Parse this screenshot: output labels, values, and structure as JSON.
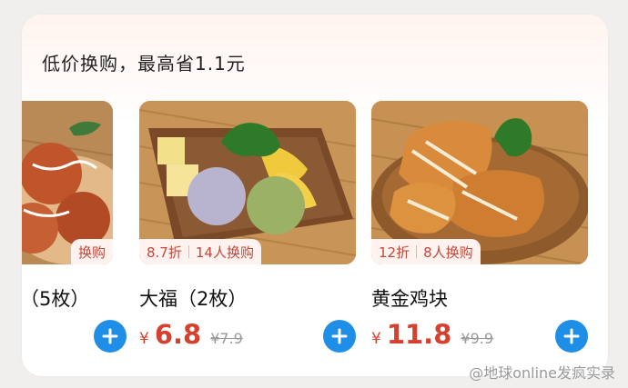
{
  "section": {
    "title": "低价换购，最高省1.1元"
  },
  "items": [
    {
      "name": "（5枚）",
      "tag_text": "换购",
      "price_yen": "",
      "price": "",
      "old_price": ""
    },
    {
      "name": "大福（2枚）",
      "tag_discount": "8.7折",
      "tag_buyers": "14人换购",
      "price_yen": "¥",
      "price": "6.8",
      "old_price": "¥7.9"
    },
    {
      "name": "黄金鸡块",
      "tag_discount": "12折",
      "tag_buyers": "8人换购",
      "price_yen": "¥",
      "price": "11.8",
      "old_price": "¥9.9"
    }
  ],
  "watermark": "@地球online发疯实录",
  "colors": {
    "accent_blue": "#1f8ee6",
    "price_red": "#d6402f",
    "tag_bg": "#fff2ef"
  },
  "icons": {
    "add": "plus-icon",
    "weibo": "weibo-icon"
  }
}
